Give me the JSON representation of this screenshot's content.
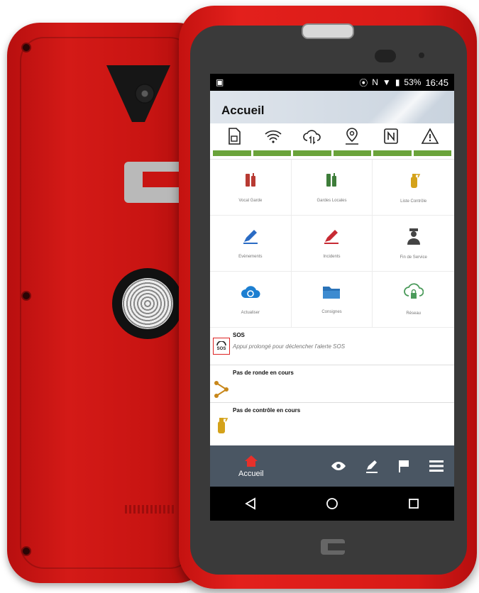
{
  "statusbar": {
    "battery": "53%",
    "time": "16:45"
  },
  "header": {
    "title": "Accueil"
  },
  "status_icons": [
    "sim-icon",
    "wifi-icon",
    "cloud-sync-icon",
    "location-icon",
    "nfc-icon",
    "warning-icon"
  ],
  "tiles": [
    {
      "label": "Vocal Garde",
      "icon": "walkie-talkie-icon",
      "color": "#b83a33"
    },
    {
      "label": "Gardes Locales",
      "icon": "walkie-talkie-icon",
      "color": "#3e7d3a"
    },
    {
      "label": "Liste Contrôle",
      "icon": "extinguisher-icon",
      "color": "#d4a21a"
    },
    {
      "label": "Evènements",
      "icon": "pen-icon",
      "color": "#2a6bc4"
    },
    {
      "label": "Incidents",
      "icon": "pen-icon",
      "color": "#c72a33"
    },
    {
      "label": "Fin de Service",
      "icon": "guard-icon",
      "color": "#444444"
    },
    {
      "label": "Actualiser",
      "icon": "cloud-refresh-icon",
      "color": "#1d7fd1"
    },
    {
      "label": "Consignes",
      "icon": "folder-icon",
      "color": "#2a73b8"
    },
    {
      "label": "Réseau",
      "icon": "cloud-lock-icon",
      "color": "#4a9a5a"
    }
  ],
  "sos": {
    "title": "SOS",
    "subtitle": "Appui prolongé pour déclencher l'alerte SOS",
    "badge": "SOS"
  },
  "ronde": {
    "title": "Pas de ronde en cours"
  },
  "controle": {
    "title": "Pas de contrôle en cours"
  },
  "bottomnav": {
    "home_label": "Accueil",
    "accent": "#e8302a"
  }
}
